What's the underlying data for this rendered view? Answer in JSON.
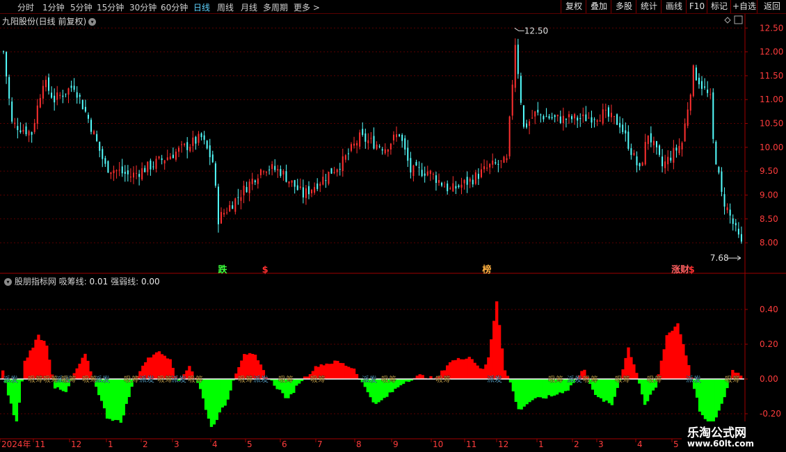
{
  "toolbar": {
    "periods": [
      "分时",
      "1分钟",
      "5分钟",
      "15分钟",
      "30分钟",
      "60分钟",
      "日线",
      "周线",
      "月线",
      "多周期",
      "更多 >"
    ],
    "active_period": "日线",
    "right_buttons": [
      "复权",
      "叠加",
      "多股",
      "统计",
      "画线",
      "F10",
      "+自选",
      "返回"
    ],
    "more_label": "标记"
  },
  "stock": {
    "title": "九阳股份(日线 前复权)"
  },
  "price_chart": {
    "y_ticks": [
      "12.50",
      "12.00",
      "11.50",
      "11.00",
      "10.50",
      "10.00",
      "9.50",
      "9.00",
      "8.50",
      "8.00"
    ],
    "y_values": [
      12.5,
      12.0,
      11.5,
      11.0,
      10.5,
      10.0,
      9.5,
      9.0,
      8.5,
      8.0
    ],
    "high_label": "12.50",
    "low_label": "7.68",
    "markers": [
      {
        "text": "跌",
        "color": "#3cff3c",
        "x_frac": 0.293
      },
      {
        "text": "$",
        "color": "#ff3030",
        "x_frac": 0.352
      },
      {
        "text": "榜",
        "color": "#ffb040",
        "x_frac": 0.648
      },
      {
        "text": "涨财",
        "color": "#ff6060",
        "x_frac": 0.902
      },
      {
        "text": "$",
        "color": "#ff3030",
        "x_frac": 0.925
      }
    ]
  },
  "indicator": {
    "name": "股朋指标网",
    "line1_label": "吸筹线:",
    "line1_value": "0.01",
    "line2_label": "强弱线:",
    "line2_value": "0.00",
    "y_ticks": [
      "0.40",
      "0.20",
      "0.00",
      "-0.20"
    ],
    "y_values": [
      0.4,
      0.2,
      0.0,
      -0.2
    ],
    "labels_buy": "吸筹",
    "labels_sell": "派发"
  },
  "x_axis": {
    "labels": [
      "2024年",
      "11",
      "12",
      "1",
      "2",
      "3",
      "4",
      "5",
      "6",
      "7",
      "8",
      "9",
      "10",
      "11",
      "12",
      "1",
      "2",
      "3",
      "4",
      "5"
    ]
  },
  "chart_data": {
    "type": "candlestick+bar",
    "price_range": [
      7.68,
      12.5
    ],
    "indicator_range": [
      -0.3,
      0.55
    ],
    "colors": {
      "up": "#ff3030",
      "down": "#54ffff",
      "pos": "#ff0000",
      "neg": "#00ff00"
    }
  },
  "watermark": {
    "cn": "乐淘公式网",
    "url": "www.60lt.com"
  }
}
